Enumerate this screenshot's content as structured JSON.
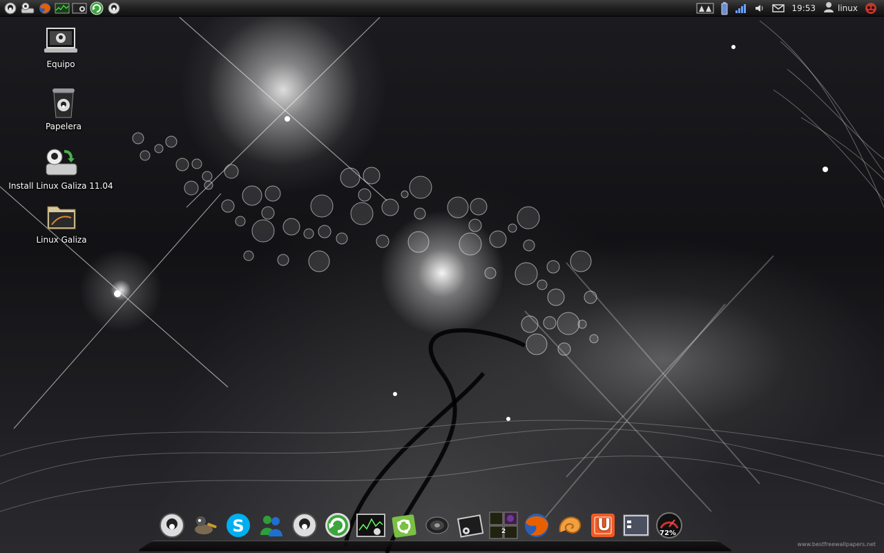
{
  "top_panel": {
    "launchers": [
      {
        "icon": "galiza-penguin-icon"
      },
      {
        "icon": "galiza-drive-icon"
      },
      {
        "icon": "firefox-icon"
      },
      {
        "icon": "system-monitor-icon"
      },
      {
        "icon": "terminal-icon"
      },
      {
        "icon": "update-manager-icon"
      },
      {
        "icon": "galiza-penguin-icon"
      }
    ],
    "tray": {
      "clock": "19:53",
      "user": "linux",
      "icons": [
        "network-applet-icon",
        "battery-icon",
        "signal-icon",
        "volume-icon",
        "mail-icon",
        "user-icon",
        "shutdown-icon"
      ]
    }
  },
  "desktop": {
    "icons": [
      {
        "label": "Equipo",
        "icon": "computer-icon"
      },
      {
        "label": "Papelera",
        "icon": "trash-icon"
      },
      {
        "label": "Install Linux Galiza 11.04",
        "icon": "installer-icon"
      },
      {
        "label": "Linux Galiza",
        "icon": "folder-icon"
      }
    ]
  },
  "dock": {
    "items": [
      {
        "icon": "galiza-penguin-icon"
      },
      {
        "icon": "gimp-icon"
      },
      {
        "icon": "skype-icon"
      },
      {
        "icon": "messenger-icon"
      },
      {
        "icon": "galiza-penguin-icon"
      },
      {
        "icon": "update-manager-icon"
      },
      {
        "icon": "system-monitor-icon"
      },
      {
        "icon": "ubuntu-software-icon"
      },
      {
        "icon": "speaker-icon"
      },
      {
        "icon": "terminal-icon"
      },
      {
        "icon": "workspace-switcher-icon",
        "badge": "2"
      },
      {
        "icon": "firefox-icon"
      },
      {
        "icon": "nautilus-icon"
      },
      {
        "icon": "ubuntu-one-icon",
        "letter": "U"
      },
      {
        "icon": "show-desktop-icon"
      },
      {
        "icon": "cpu-gauge-icon",
        "badge": "72%"
      }
    ],
    "watermark": "www.bestfreewallpapers.net"
  },
  "colors": {
    "panel_bg": "#1e1e1e",
    "text": "#e8e8e8",
    "firefox_orange": "#e66000",
    "skype_blue": "#00aff0",
    "ubuntu_green": "#7ac143",
    "ubuntu_one_orange": "#ef5a24",
    "shutdown_red": "#c0392b"
  }
}
